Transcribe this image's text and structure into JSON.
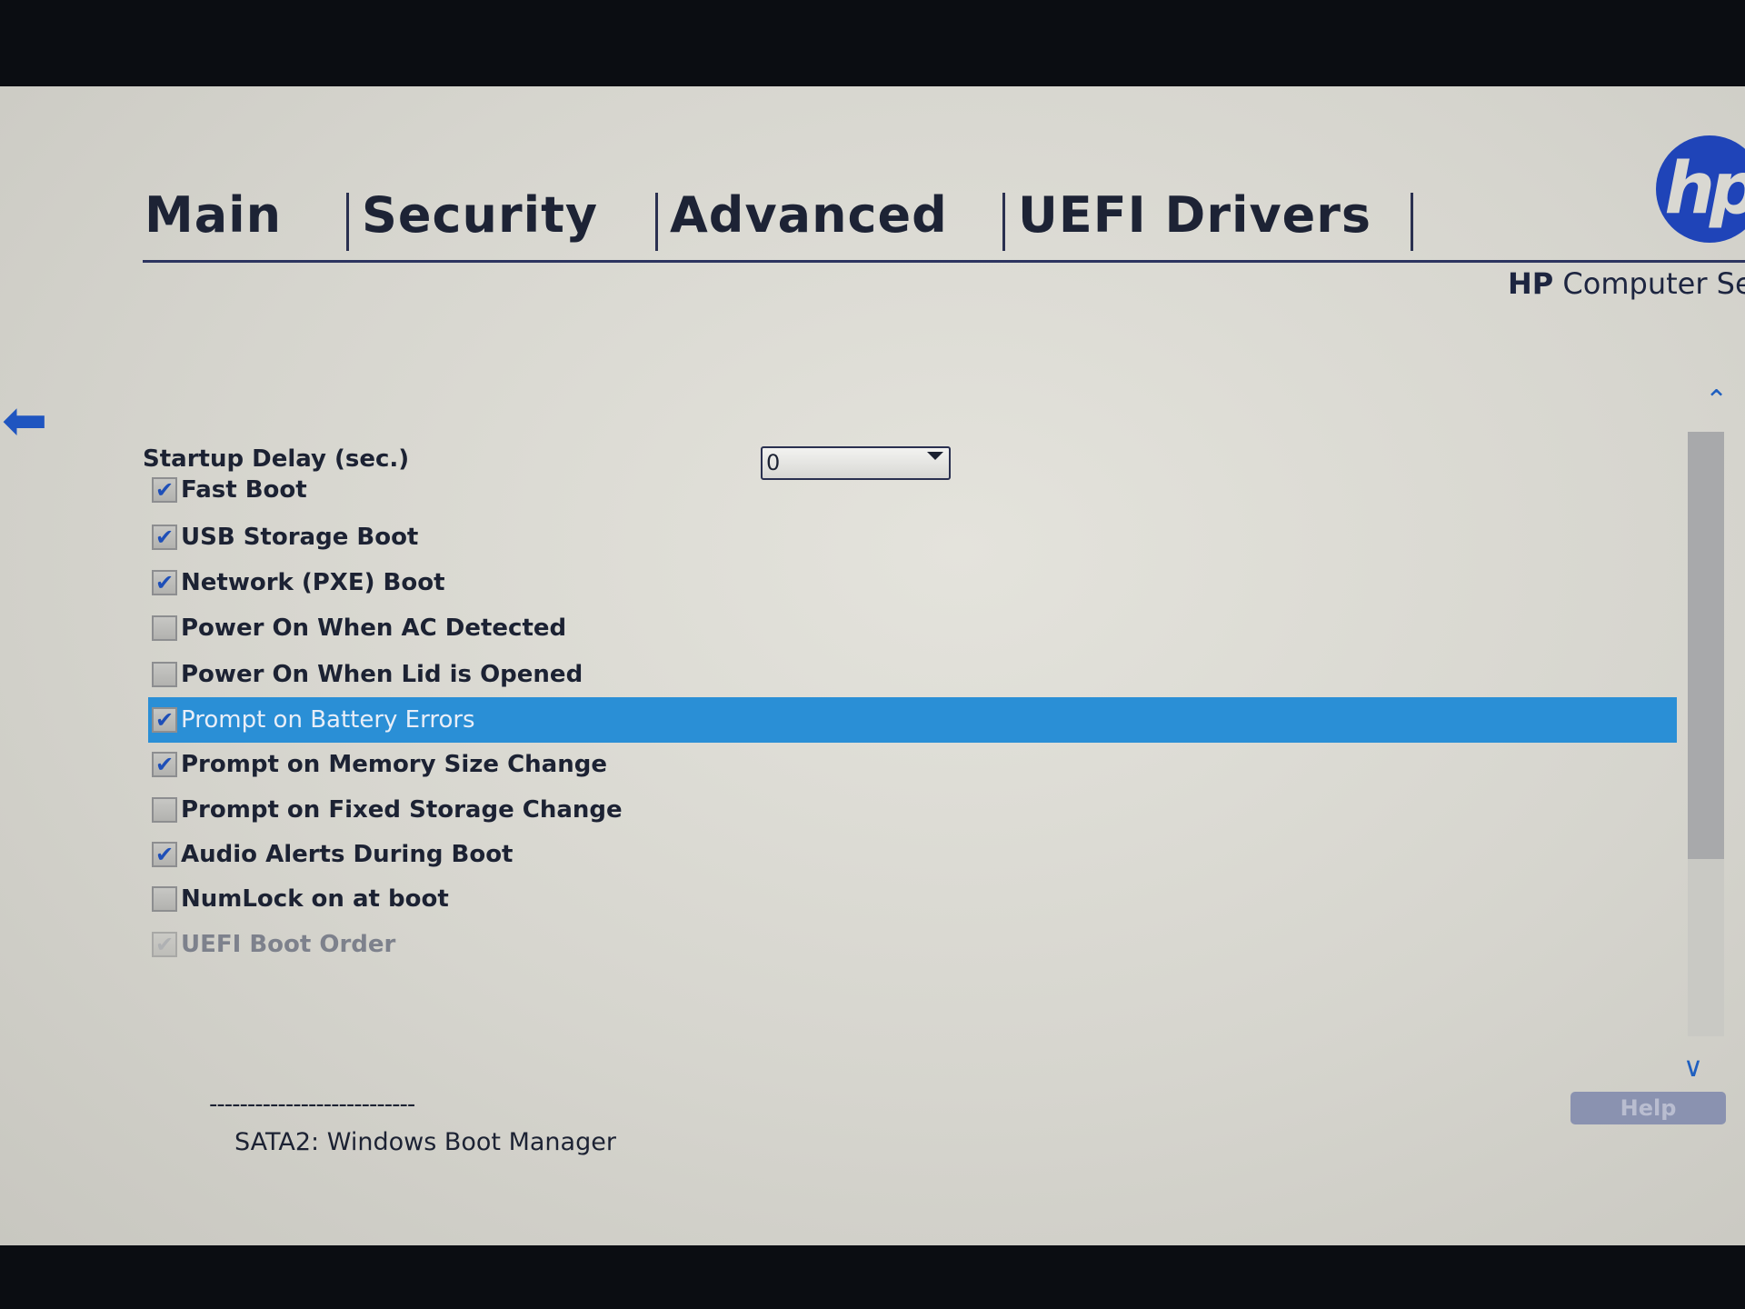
{
  "tabs": [
    {
      "label": "Main"
    },
    {
      "label": "Security"
    },
    {
      "label": "Advanced"
    },
    {
      "label": "UEFI Drivers"
    }
  ],
  "brand": {
    "logo": "hp",
    "title_bold": "HP",
    "title_rest": "Computer Setu"
  },
  "icons": {
    "back": "back-arrow-icon",
    "scroll_up": "scroll-up-icon",
    "scroll_down": "chevron-down-icon"
  },
  "startup_delay": {
    "label": "Startup Delay (sec.)",
    "value": "0"
  },
  "options": [
    {
      "label": "Fast Boot",
      "checked": true
    },
    {
      "label": "USB Storage Boot",
      "checked": true
    },
    {
      "label": "Network (PXE) Boot",
      "checked": true
    },
    {
      "label": "Power On When AC Detected",
      "checked": false
    },
    {
      "label": "Power On When Lid is Opened",
      "checked": false
    },
    {
      "label": "Prompt on Battery Errors",
      "checked": true,
      "selected": true
    },
    {
      "label": "Prompt on Memory Size Change",
      "checked": true
    },
    {
      "label": "Prompt on Fixed Storage Change",
      "checked": false
    },
    {
      "label": "Audio Alerts During Boot",
      "checked": true
    },
    {
      "label": "NumLock on at boot",
      "checked": false
    },
    {
      "label": "UEFI Boot Order",
      "checked": true,
      "disabled": true
    }
  ],
  "boot_order": {
    "separator": "---------------------------",
    "entries": [
      "SATA2:  Windows Boot Manager"
    ]
  },
  "help_label": "Help",
  "colors": {
    "accent": "#2a8fd6",
    "logo": "#1f44b8"
  }
}
